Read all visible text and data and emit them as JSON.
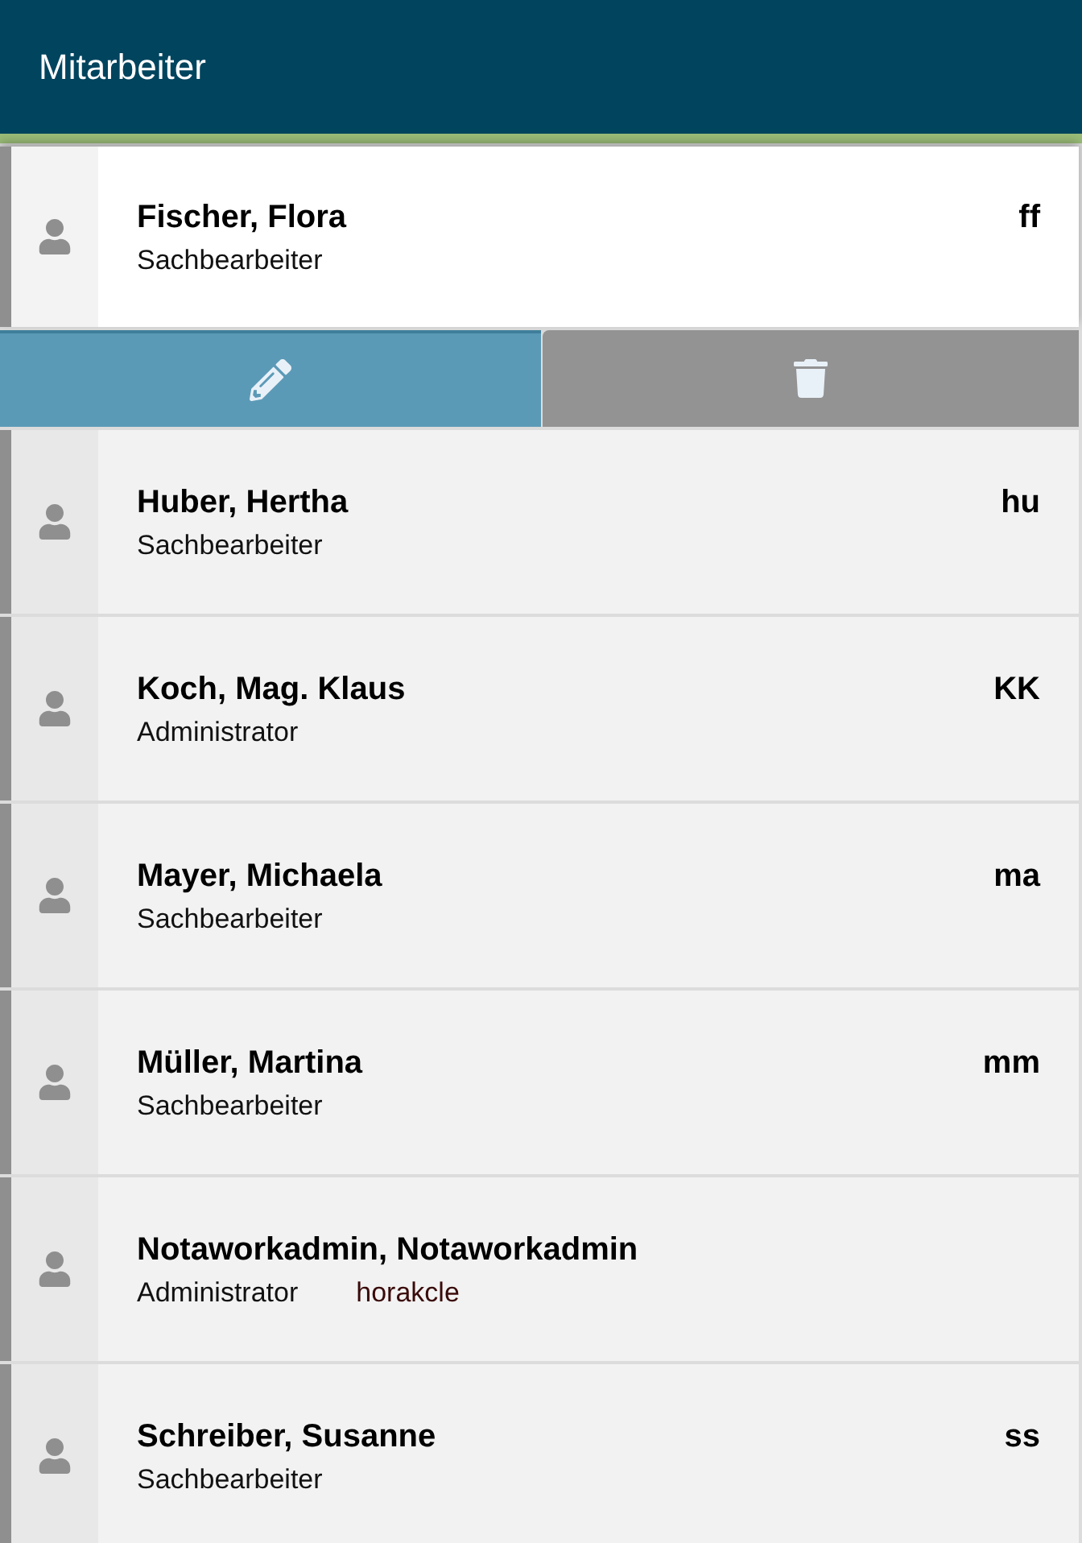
{
  "header": {
    "title": "Mitarbeiter"
  },
  "employees": [
    {
      "name": "Fischer, Flora",
      "role": "Sachbearbeiter",
      "abbreviation": "ff",
      "selected": true
    },
    {
      "name": "Huber, Hertha",
      "role": "Sachbearbeiter",
      "abbreviation": "hu",
      "selected": false
    },
    {
      "name": "Koch, Mag. Klaus",
      "role": "Administrator",
      "abbreviation": "KK",
      "selected": false
    },
    {
      "name": "Mayer, Michaela",
      "role": "Sachbearbeiter",
      "abbreviation": "ma",
      "selected": false
    },
    {
      "name": "Müller, Martina",
      "role": "Sachbearbeiter",
      "abbreviation": "mm",
      "selected": false
    },
    {
      "name": "Notaworkadmin, Notaworkadmin",
      "role": "Administrator",
      "login": "horakcle",
      "selected": false
    },
    {
      "name": "Schreiber, Susanne",
      "role": "Sachbearbeiter",
      "abbreviation": "ss",
      "selected": false
    }
  ]
}
